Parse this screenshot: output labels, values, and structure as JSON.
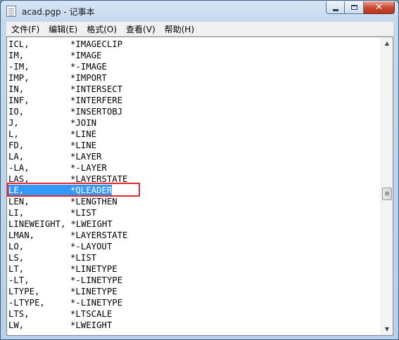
{
  "window": {
    "title": "acad.pgp - 记事本"
  },
  "menu": [
    {
      "label": "文件(F)"
    },
    {
      "label": "编辑(E)"
    },
    {
      "label": "格式(O)"
    },
    {
      "label": "查看(V)"
    },
    {
      "label": "帮助(H)"
    }
  ],
  "editor": {
    "lines": [
      {
        "alias": "ICL,",
        "command": "*IMAGECLIP"
      },
      {
        "alias": "IM,",
        "command": "*IMAGE"
      },
      {
        "alias": "-IM,",
        "command": "*-IMAGE"
      },
      {
        "alias": "IMP,",
        "command": "*IMPORT"
      },
      {
        "alias": "IN,",
        "command": "*INTERSECT"
      },
      {
        "alias": "INF,",
        "command": "*INTERFERE"
      },
      {
        "alias": "IO,",
        "command": "*INSERTOBJ"
      },
      {
        "alias": "J,",
        "command": "*JOIN"
      },
      {
        "alias": "L,",
        "command": "*LINE"
      },
      {
        "alias": "FD,",
        "command": "*LINE"
      },
      {
        "alias": "LA,",
        "command": "*LAYER"
      },
      {
        "alias": "-LA,",
        "command": "*-LAYER"
      },
      {
        "alias": "LAS,",
        "command": "*LAYERSTATE"
      },
      {
        "alias": "LE,",
        "command": "*QLEADER"
      },
      {
        "alias": "LEN,",
        "command": "*LENGTHEN"
      },
      {
        "alias": "LI,",
        "command": "*LIST"
      },
      {
        "alias": "LINEWEIGHT,",
        "command": "*LWEIGHT"
      },
      {
        "alias": "LMAN,",
        "command": "*LAYERSTATE"
      },
      {
        "alias": "LO,",
        "command": "*-LAYOUT"
      },
      {
        "alias": "LS,",
        "command": "*LIST"
      },
      {
        "alias": "LT,",
        "command": "*LINETYPE"
      },
      {
        "alias": "-LT,",
        "command": "*-LINETYPE"
      },
      {
        "alias": "LTYPE,",
        "command": "*LINETYPE"
      },
      {
        "alias": "-LTYPE,",
        "command": "*-LINETYPE"
      },
      {
        "alias": "LTS,",
        "command": "*LTSCALE"
      },
      {
        "alias": "LW,",
        "command": "*LWEIGHT"
      }
    ],
    "selected_line": 13,
    "highlight_color": "#e8262a",
    "selection_color": "#3399ff"
  }
}
